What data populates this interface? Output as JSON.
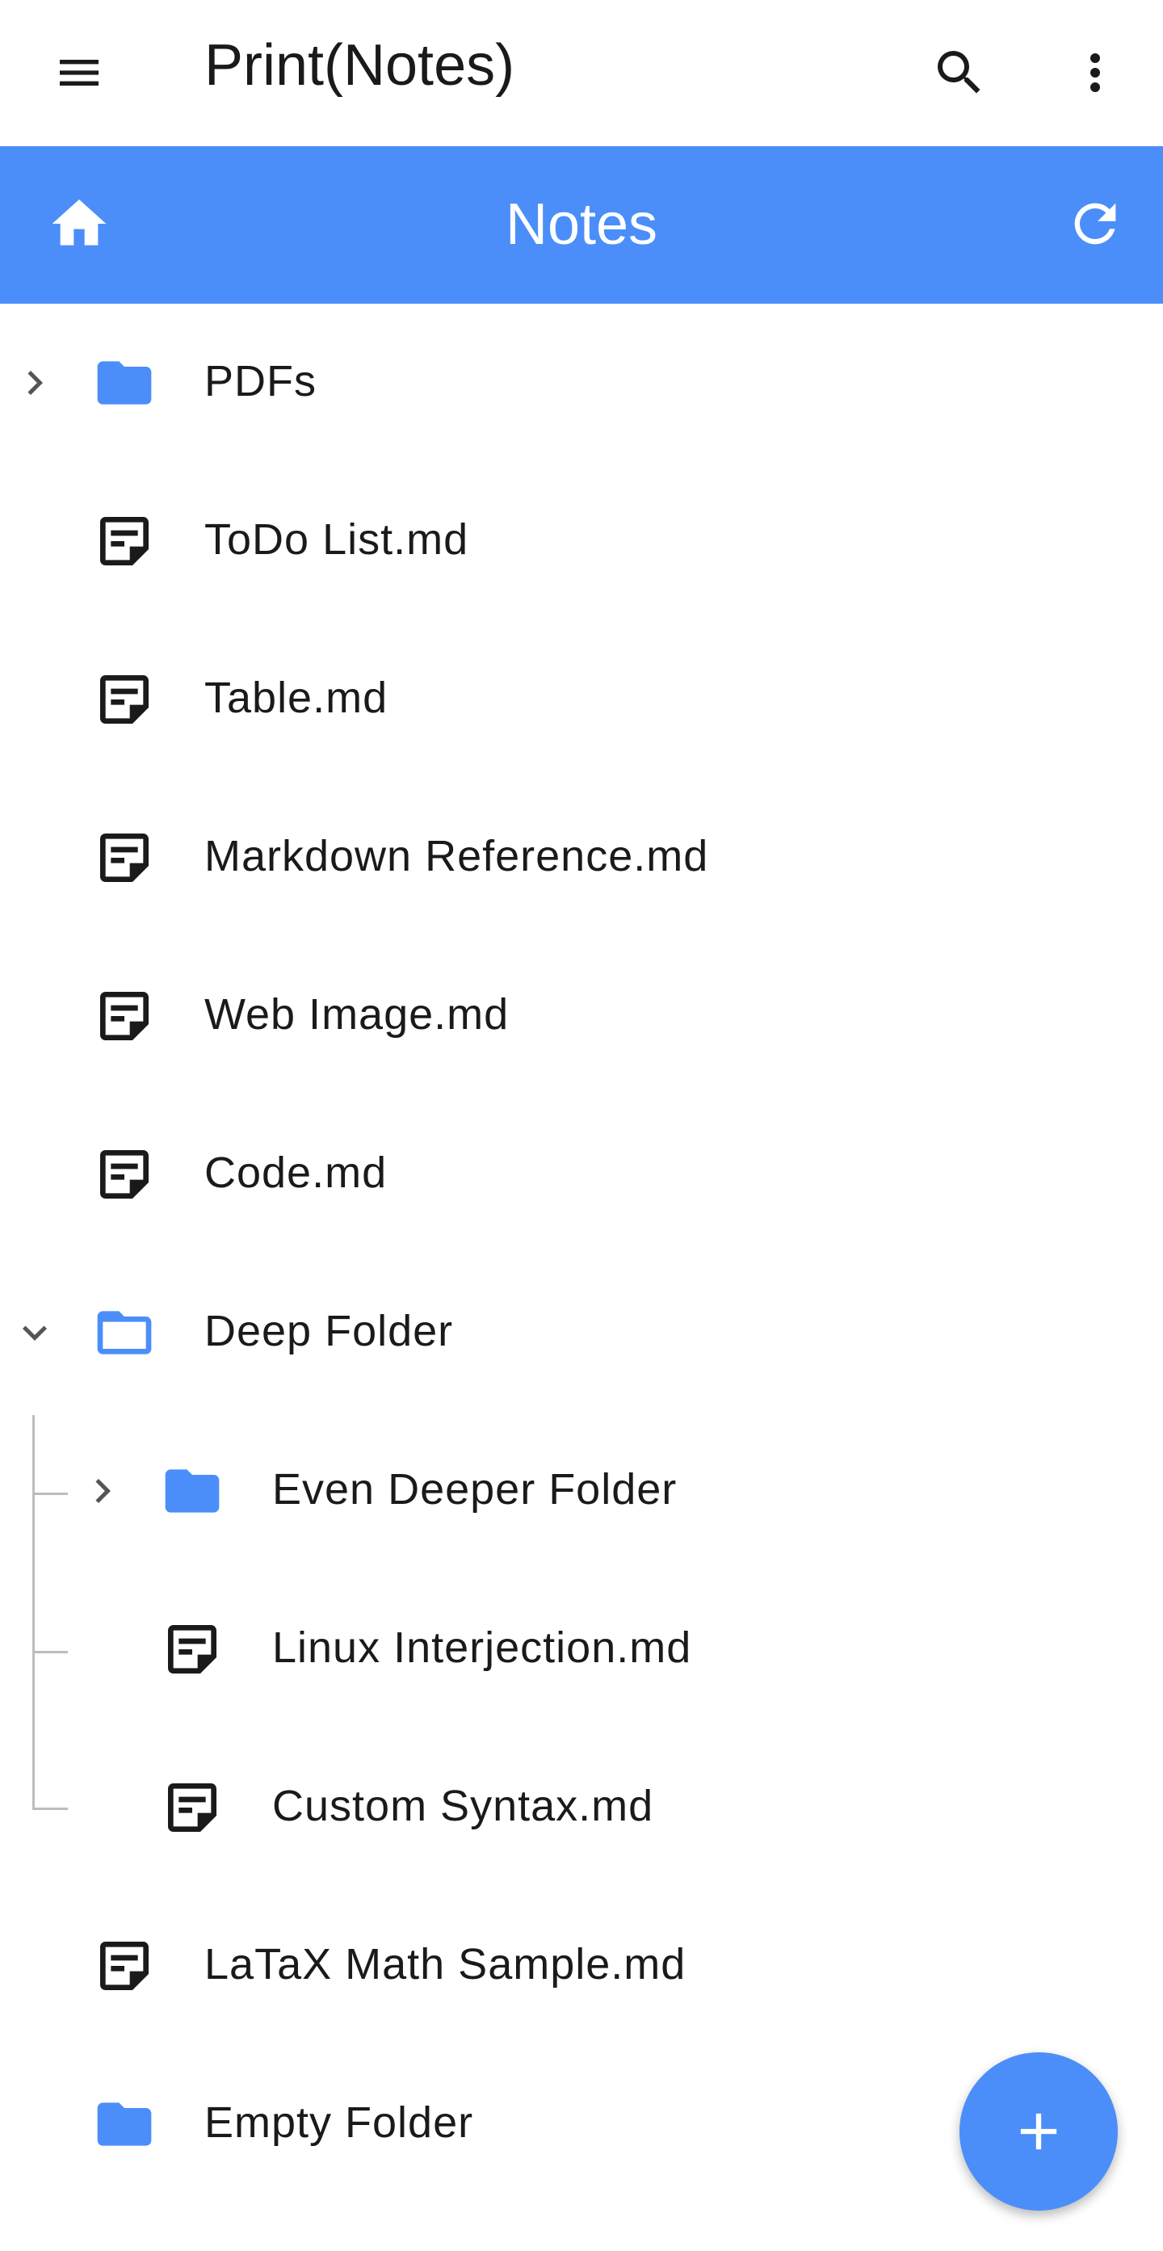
{
  "topbar": {
    "title": "Print(Notes)",
    "menu_icon": "hamburger-menu-icon",
    "search_icon": "search-icon",
    "more_icon": "more-vert-icon"
  },
  "header": {
    "title": "Notes",
    "home_icon": "home-icon",
    "refresh_icon": "refresh-icon"
  },
  "tree": {
    "items": [
      {
        "label": "PDFs",
        "type": "folder",
        "expanded": false
      },
      {
        "label": "ToDo List.md",
        "type": "note"
      },
      {
        "label": "Table.md",
        "type": "note"
      },
      {
        "label": "Markdown Reference.md",
        "type": "note"
      },
      {
        "label": "Web Image.md",
        "type": "note"
      },
      {
        "label": "Code.md",
        "type": "note"
      },
      {
        "label": "Deep Folder",
        "type": "folder",
        "expanded": true
      },
      {
        "label": "Even Deeper Folder",
        "type": "folder",
        "expanded": false
      },
      {
        "label": "Linux Interjection.md",
        "type": "note"
      },
      {
        "label": "Custom Syntax.md",
        "type": "note"
      },
      {
        "label": "LaTaX Math Sample.md",
        "type": "note"
      },
      {
        "label": "Empty Folder",
        "type": "folder"
      }
    ]
  },
  "fab": {
    "icon": "plus-icon"
  },
  "colors": {
    "accent": "#4b8ef9",
    "text": "#1a1a1a",
    "icon": "#1a1a1a",
    "guide": "#bdbdbd"
  }
}
